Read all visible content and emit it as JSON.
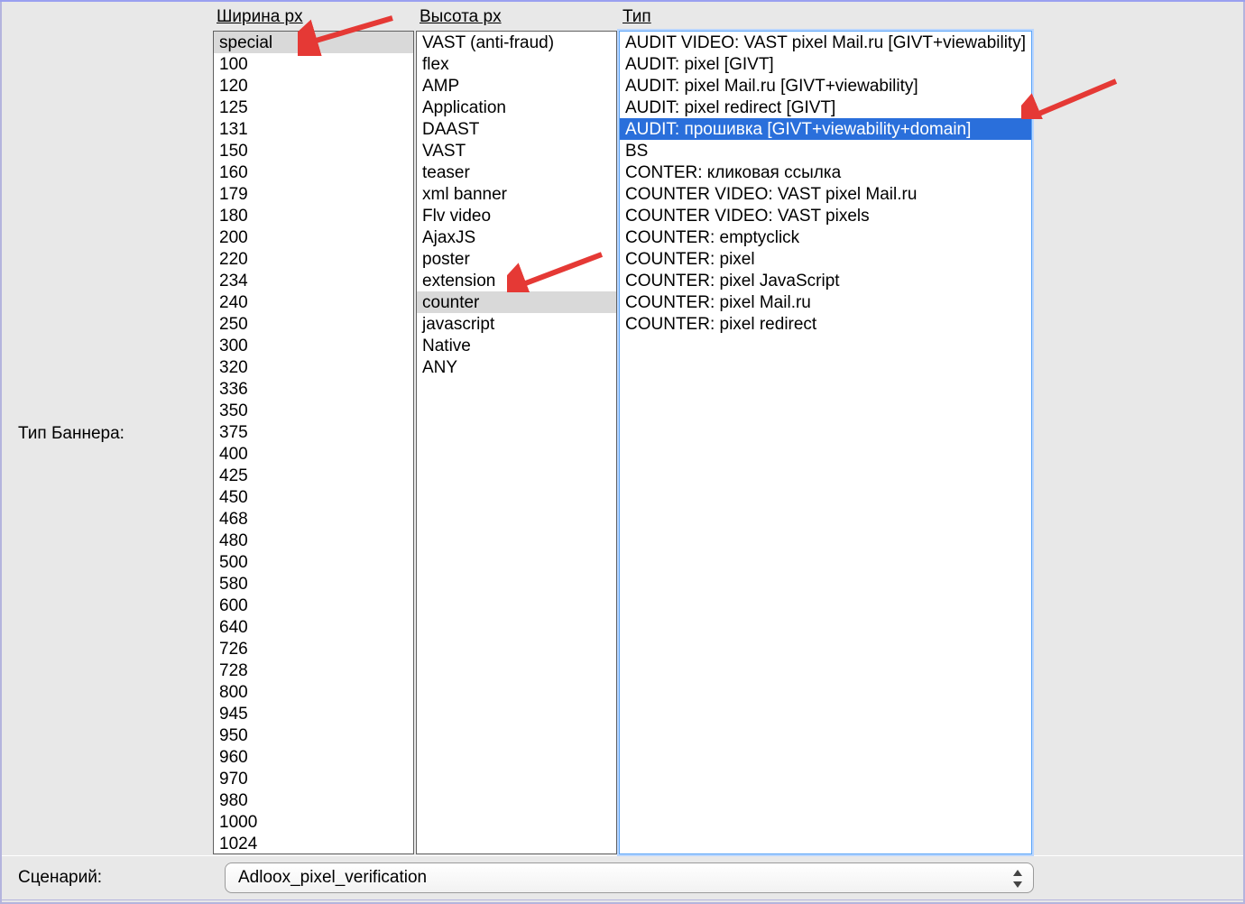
{
  "labels": {
    "banner_type": "Тип Баннера:",
    "scenario": "Сценарий:"
  },
  "columns": {
    "width": {
      "header": "Ширина px"
    },
    "height": {
      "header": "Высота px"
    },
    "type": {
      "header": "Тип"
    }
  },
  "width_items": [
    "special",
    "100",
    "120",
    "125",
    "131",
    "150",
    "160",
    "179",
    "180",
    "200",
    "220",
    "234",
    "240",
    "250",
    "300",
    "320",
    "336",
    "350",
    "375",
    "400",
    "425",
    "450",
    "468",
    "480",
    "500",
    "580",
    "600",
    "640",
    "726",
    "728",
    "800",
    "945",
    "950",
    "960",
    "970",
    "980",
    "1000",
    "1024"
  ],
  "width_selected_index": 0,
  "height_items": [
    "VAST (anti-fraud)",
    "flex",
    "AMP",
    "Application",
    "DAAST",
    "VAST",
    "teaser",
    "xml banner",
    "Flv video",
    "AjaxJS",
    "poster",
    "extension",
    "counter",
    "javascript",
    "Native",
    "ANY"
  ],
  "height_selected_index": 12,
  "type_items": [
    "AUDIT VIDEO: VAST pixel Mail.ru [GIVT+viewability]",
    "AUDIT: pixel [GIVT]",
    "AUDIT: pixel Mail.ru [GIVT+viewability]",
    "AUDIT: pixel redirect [GIVT]",
    "AUDIT: прошивка [GIVT+viewability+domain]",
    "BS",
    "CONTER: кликовая ссылка",
    "COUNTER VIDEO: VAST pixel Mail.ru",
    "COUNTER VIDEO: VAST pixels",
    "COUNTER: emptyclick",
    "COUNTER: pixel",
    "COUNTER: pixel JavaScript",
    "COUNTER: pixel Mail.ru",
    "COUNTER: pixel redirect"
  ],
  "type_selected_index": 4,
  "scenario": {
    "value": "Adloox_pixel_verification"
  },
  "colors": {
    "selection_active": "#2a6fdb",
    "selection_inactive": "#d9d9d9",
    "bg": "#e8e8e8",
    "arrow": "#e53935"
  }
}
